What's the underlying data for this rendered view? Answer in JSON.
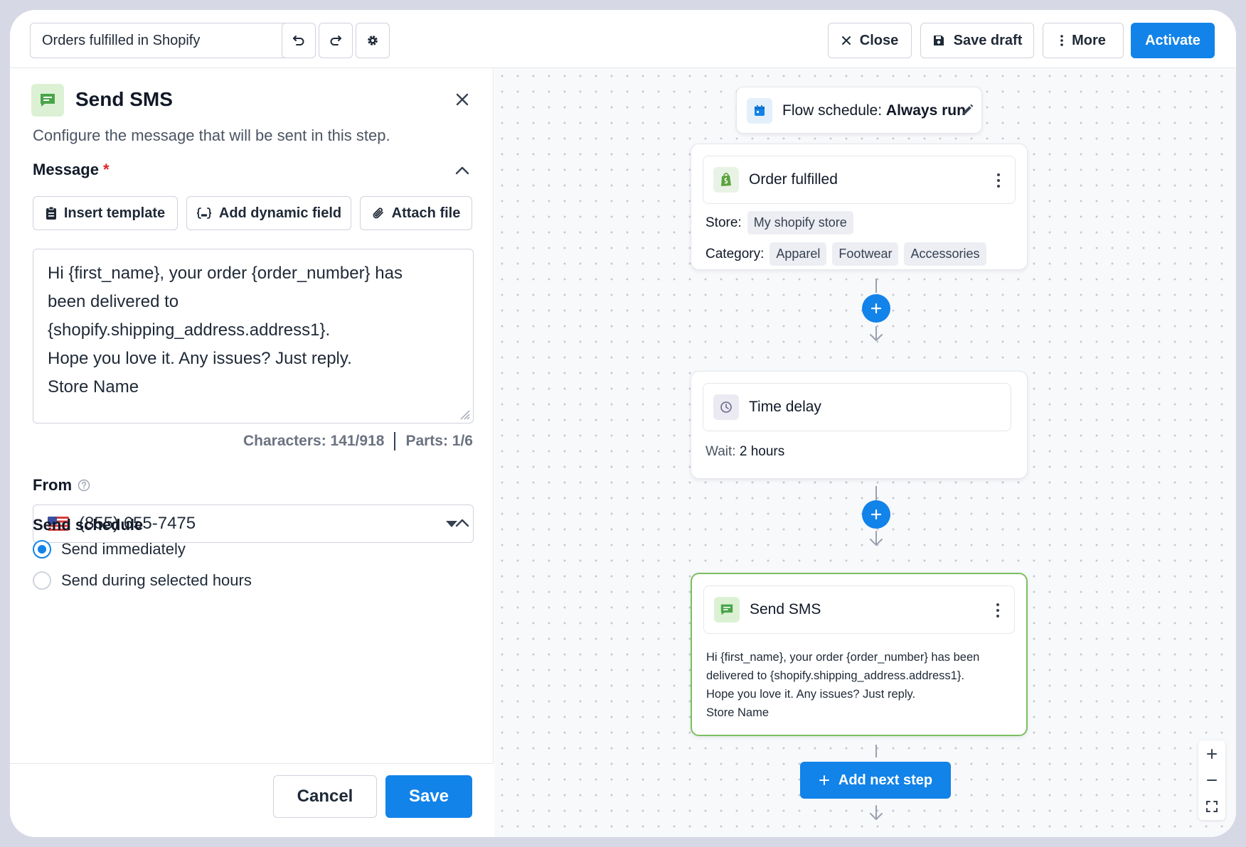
{
  "topbar": {
    "flow_name": "Orders fulfilled in Shopify",
    "close_label": "Close",
    "save_draft_label": "Save draft",
    "more_label": "More",
    "activate_label": "Activate"
  },
  "panel": {
    "title": "Send SMS",
    "subtitle": "Configure the message that will be sent in this step.",
    "message_label": "Message",
    "required_mark": "*",
    "insert_template_label": "Insert template",
    "add_dynamic_field_label": "Add dynamic field",
    "attach_file_label": "Attach file",
    "message_lines": [
      "Hi {first_name}, your order {order_number} has",
      "been delivered to",
      "{shopify.shipping_address.address1}.",
      "Hope you love it. Any issues? Just reply.",
      "Store Name"
    ],
    "characters": "Characters: 141/918",
    "parts": "Parts: 1/6",
    "from_label": "From",
    "from_value": "(855) 655-7475",
    "schedule_label": "Send schedule",
    "schedule_options": [
      "Send immediately",
      "Send during selected hours"
    ],
    "cancel_label": "Cancel",
    "save_label": "Save"
  },
  "canvas": {
    "schedule_prefix": "Flow schedule:",
    "schedule_value": "Always run",
    "order_card": {
      "title": "Order fulfilled",
      "store_label": "Store:",
      "store_value": "My shopify store",
      "category_label": "Category:",
      "categories": [
        "Apparel",
        "Footwear",
        "Accessories"
      ]
    },
    "delay_card": {
      "title": "Time delay",
      "wait_label": "Wait:",
      "wait_value": "2 hours"
    },
    "sms_card": {
      "title": "Send SMS",
      "lines": [
        "Hi {first_name}, your order {order_number} has been",
        "delivered to {shopify.shipping_address.address1}.",
        "Hope you love it. Any issues? Just reply.",
        "Store Name"
      ]
    },
    "add_next_step_label": "Add next step"
  },
  "colors": {
    "primary": "#1283e9",
    "sms_icon_bg": "#dcf1d4",
    "sms_icon": "#4aa54a",
    "selected_card_border": "#7bbf5e"
  }
}
